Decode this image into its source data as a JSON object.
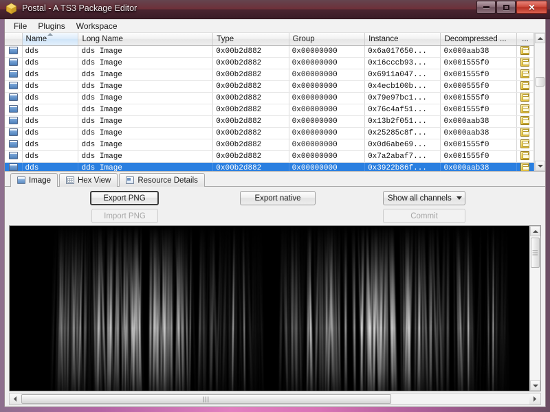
{
  "window": {
    "title": "Postal - A TS3 Package Editor",
    "app_icon": "package-box-icon",
    "controls": {
      "minimize": "minimize-icon",
      "maximize": "maximize-icon",
      "close": "✕"
    },
    "border_color": "#e27fc0",
    "titlebar_color": "#5f2c36"
  },
  "menubar": {
    "items": [
      {
        "label": "File"
      },
      {
        "label": "Plugins"
      },
      {
        "label": "Workspace"
      }
    ]
  },
  "resource_table": {
    "columns": [
      {
        "label": ""
      },
      {
        "label": "Name",
        "sorted": true
      },
      {
        "label": "Long Name"
      },
      {
        "label": "Type"
      },
      {
        "label": "Group"
      },
      {
        "label": "Instance"
      },
      {
        "label": "Decompressed ..."
      },
      {
        "label": "..."
      }
    ],
    "rows": [
      {
        "name": "dds",
        "long_name": "dds Image",
        "type": "0x00b2d882",
        "group": "0x00000000",
        "instance": "0x6a017650...",
        "decompressed": "0x000aab38",
        "selected": false
      },
      {
        "name": "dds",
        "long_name": "dds Image",
        "type": "0x00b2d882",
        "group": "0x00000000",
        "instance": "0x16cccb93...",
        "decompressed": "0x001555f0",
        "selected": false
      },
      {
        "name": "dds",
        "long_name": "dds Image",
        "type": "0x00b2d882",
        "group": "0x00000000",
        "instance": "0x6911a047...",
        "decompressed": "0x001555f0",
        "selected": false
      },
      {
        "name": "dds",
        "long_name": "dds Image",
        "type": "0x00b2d882",
        "group": "0x00000000",
        "instance": "0x4ecb100b...",
        "decompressed": "0x000555f0",
        "selected": false
      },
      {
        "name": "dds",
        "long_name": "dds Image",
        "type": "0x00b2d882",
        "group": "0x00000000",
        "instance": "0x79e97bc1...",
        "decompressed": "0x001555f0",
        "selected": false
      },
      {
        "name": "dds",
        "long_name": "dds Image",
        "type": "0x00b2d882",
        "group": "0x00000000",
        "instance": "0x76c4af51...",
        "decompressed": "0x001555f0",
        "selected": false
      },
      {
        "name": "dds",
        "long_name": "dds Image",
        "type": "0x00b2d882",
        "group": "0x00000000",
        "instance": "0x13b2f051...",
        "decompressed": "0x000aab38",
        "selected": false
      },
      {
        "name": "dds",
        "long_name": "dds Image",
        "type": "0x00b2d882",
        "group": "0x00000000",
        "instance": "0x25285c8f...",
        "decompressed": "0x000aab38",
        "selected": false
      },
      {
        "name": "dds",
        "long_name": "dds Image",
        "type": "0x00b2d882",
        "group": "0x00000000",
        "instance": "0x0d6abe69...",
        "decompressed": "0x001555f0",
        "selected": false
      },
      {
        "name": "dds",
        "long_name": "dds Image",
        "type": "0x00b2d882",
        "group": "0x00000000",
        "instance": "0x7a2abaf7...",
        "decompressed": "0x001555f0",
        "selected": false
      },
      {
        "name": "dds",
        "long_name": "dds Image",
        "type": "0x00b2d882",
        "group": "0x00000000",
        "instance": "0x3922b86f...",
        "decompressed": "0x000aab38",
        "selected": true
      }
    ]
  },
  "tabs": [
    {
      "label": "Image",
      "icon": "image-icon",
      "active": true
    },
    {
      "label": "Hex View",
      "icon": "hex-grid-icon",
      "active": false
    },
    {
      "label": "Resource Details",
      "icon": "resource-details-icon",
      "active": false
    }
  ],
  "toolpanel": {
    "export_png": "Export PNG",
    "import_png": "Import PNG",
    "export_native": "Export native",
    "channels_selected": "Show all channels",
    "commit": "Commit"
  },
  "viewer": {
    "scrollbar_grip": "|||"
  }
}
